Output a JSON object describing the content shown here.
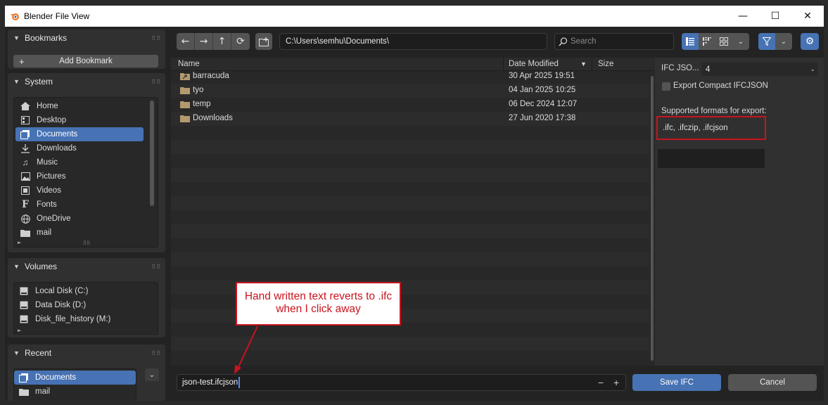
{
  "window": {
    "title": "Blender File View",
    "minimize": "—",
    "maximize": "☐",
    "close": "✕"
  },
  "sidebar": {
    "bookmarks": {
      "title": "Bookmarks",
      "add_label": "Add Bookmark"
    },
    "system": {
      "title": "System",
      "items": [
        {
          "label": "Home",
          "icon": "home-icon"
        },
        {
          "label": "Desktop",
          "icon": "desktop-icon"
        },
        {
          "label": "Documents",
          "icon": "documents-icon",
          "selected": true
        },
        {
          "label": "Downloads",
          "icon": "download-icon"
        },
        {
          "label": "Music",
          "icon": "music-icon"
        },
        {
          "label": "Pictures",
          "icon": "picture-icon"
        },
        {
          "label": "Videos",
          "icon": "video-icon"
        },
        {
          "label": "Fonts",
          "icon": "font-icon"
        },
        {
          "label": "OneDrive",
          "icon": "globe-icon"
        },
        {
          "label": "mail",
          "icon": "folder-icon"
        }
      ]
    },
    "volumes": {
      "title": "Volumes",
      "items": [
        {
          "label": "Local Disk (C:)",
          "icon": "disk-icon"
        },
        {
          "label": "Data Disk (D:)",
          "icon": "disk-icon"
        },
        {
          "label": "Disk_file_history (M:)",
          "icon": "disk-icon"
        }
      ]
    },
    "recent": {
      "title": "Recent",
      "items": [
        {
          "label": "Documents",
          "icon": "documents-icon",
          "selected": true
        },
        {
          "label": "mail",
          "icon": "folder-icon"
        }
      ]
    }
  },
  "toolbar": {
    "path": "C:\\Users\\semhu\\Documents\\",
    "search_placeholder": "Search"
  },
  "file_list": {
    "columns": {
      "name": "Name",
      "date": "Date Modified",
      "size": "Size"
    },
    "rows": [
      {
        "name": "barracuda",
        "date": "30 Apr 2025 19:51"
      },
      {
        "name": "tyo",
        "date": "04 Jan 2025 10:25"
      },
      {
        "name": "temp",
        "date": "06 Dec 2024 12:07"
      },
      {
        "name": "Downloads",
        "date": "27 Jun 2020 17:38"
      }
    ]
  },
  "options": {
    "json_label": "IFC JSO...",
    "json_value": "4",
    "compact_label": "Export Compact IFCJSON",
    "supported_label": "Supported formats for export:",
    "supported_value": ".ifc, .ifczip, .ifcjson"
  },
  "bottom": {
    "filename": "json-test.ifcjson",
    "minus": "−",
    "plus": "+",
    "save_label": "Save IFC",
    "cancel_label": "Cancel"
  },
  "annotation": {
    "line1": "Hand written text reverts to .ifc",
    "line2": "when I click away"
  },
  "colors": {
    "accent": "#4772b3",
    "annotation_red": "#c8141e",
    "folder": "#b39a6e"
  }
}
